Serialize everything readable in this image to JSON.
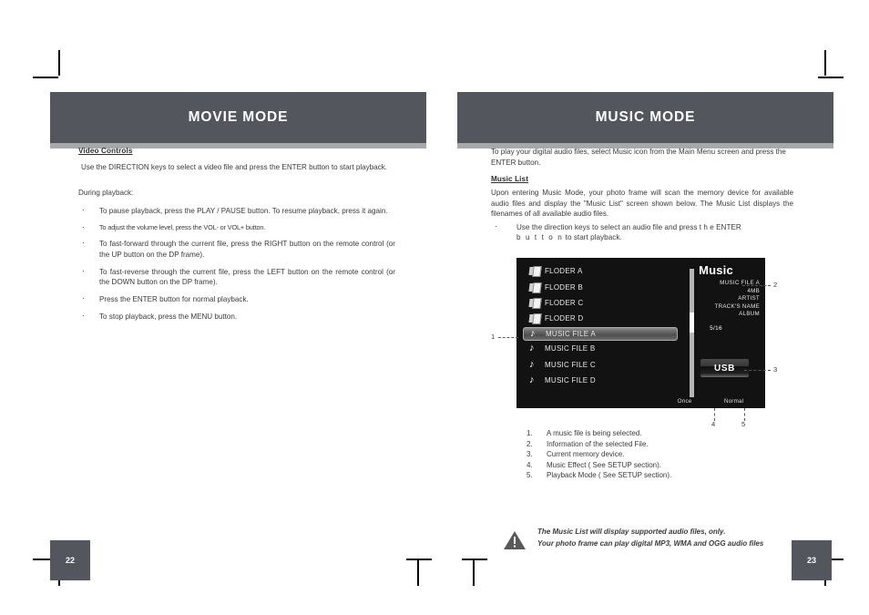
{
  "left_page": {
    "header_title": "MOVIE MODE",
    "page_number": "22",
    "section_heading": "Video Controls",
    "intro": "Use the DIRECTION keys to select a video file and press the ENTER button to start playback.",
    "during_label": "During playback:",
    "bullets": [
      "To pause playback, press the PLAY / PAUSE button. To resume playback, press it again.",
      "To adjust the volume level, press the VOL- or VOL+ button.",
      "To fast-forward through the current file, press the RIGHT button on the remote control (or the UP button on the DP frame).",
      "To fast-reverse through the current file, press the LEFT button on the remote control (or the DOWN button on the DP frame).",
      "Press the ENTER button for normal playback.",
      "To stop playback, press the MENU button."
    ]
  },
  "right_page": {
    "header_title": "MUSIC MODE",
    "page_number": "23",
    "intro": "To play your digital audio files, select Music icon from the Main Menu screen and press the ENTER button.",
    "section_heading": "Music List",
    "section_body": "Upon entering Music Mode, your photo frame will scan the memory device for available audio files and display the \"Music List\" screen shown below. The Music List displays the filenames of all available audio files.",
    "bullet_part1": "Use the direction keys to select an audio file and press t h e  ENTER",
    "bullet_part2": "b u t t o n",
    "bullet_part3": "to start playback.",
    "device": {
      "list": [
        {
          "icon": "folder-icon",
          "label": "FLODER A",
          "selected": false
        },
        {
          "icon": "folder-icon",
          "label": "FLODER B",
          "selected": false
        },
        {
          "icon": "folder-icon",
          "label": "FLODER C",
          "selected": false
        },
        {
          "icon": "folder-icon",
          "label": "FLODER D",
          "selected": false
        },
        {
          "icon": "music-note-icon",
          "label": "MUSIC FILE A",
          "selected": true
        },
        {
          "icon": "music-note-icon",
          "label": "MUSIC FILE B",
          "selected": false
        },
        {
          "icon": "music-note-icon",
          "label": "MUSIC FILE C",
          "selected": false
        },
        {
          "icon": "music-note-icon",
          "label": "MUSIC FILE D",
          "selected": false
        }
      ],
      "panel_title": "Music",
      "meta": {
        "filename": "MUSIC FILE A",
        "size": "4MB",
        "artist": "ARTIST",
        "track": "TRACK'S NAME",
        "album": "ALBUM",
        "position": "5/16"
      },
      "source_button": "USB",
      "effect_mode": "Once",
      "playback_mode": "Normal"
    },
    "callout_numbers": [
      "1",
      "2",
      "3",
      "4",
      "5"
    ],
    "legend": [
      {
        "n": "1.",
        "text": "A music file is being selected."
      },
      {
        "n": "2.",
        "text": "Information of the selected File."
      },
      {
        "n": "3.",
        "text": "Current memory device."
      },
      {
        "n": "4.",
        "text": "Music Effect ( See SETUP section)."
      },
      {
        "n": "5.",
        "text": "Playback Mode ( See SETUP section)."
      }
    ],
    "warning": {
      "icon": "warning-triangle-icon",
      "line1": "The Music List will display supported audio files, only.",
      "line2": "Your photo frame can play digital MP3, WMA and OGG audio files"
    }
  },
  "colors": {
    "header_bar": "#53565c",
    "header_under": "#a7a8ab",
    "device_bg": "#121212",
    "selection": "#6f6f6f"
  }
}
